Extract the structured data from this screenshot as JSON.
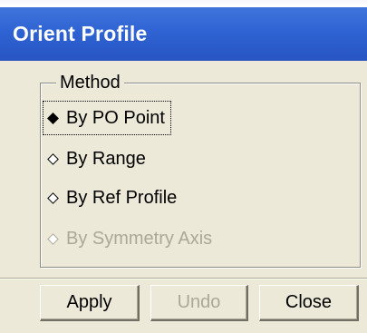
{
  "window": {
    "title": "Orient Profile"
  },
  "method_group": {
    "legend": "Method",
    "options": [
      {
        "label": "By PO Point",
        "selected": true,
        "enabled": true
      },
      {
        "label": "By Range",
        "selected": false,
        "enabled": true
      },
      {
        "label": "By Ref Profile",
        "selected": false,
        "enabled": true
      },
      {
        "label": "By Symmetry Axis",
        "selected": false,
        "enabled": false
      }
    ]
  },
  "buttons": {
    "apply_label": "Apply",
    "undo_label": "Undo",
    "close_label": "Close"
  },
  "colors": {
    "titlebar": "#2f63d3",
    "dialog_bg": "#ece9d8",
    "disabled_text": "#aca899"
  }
}
